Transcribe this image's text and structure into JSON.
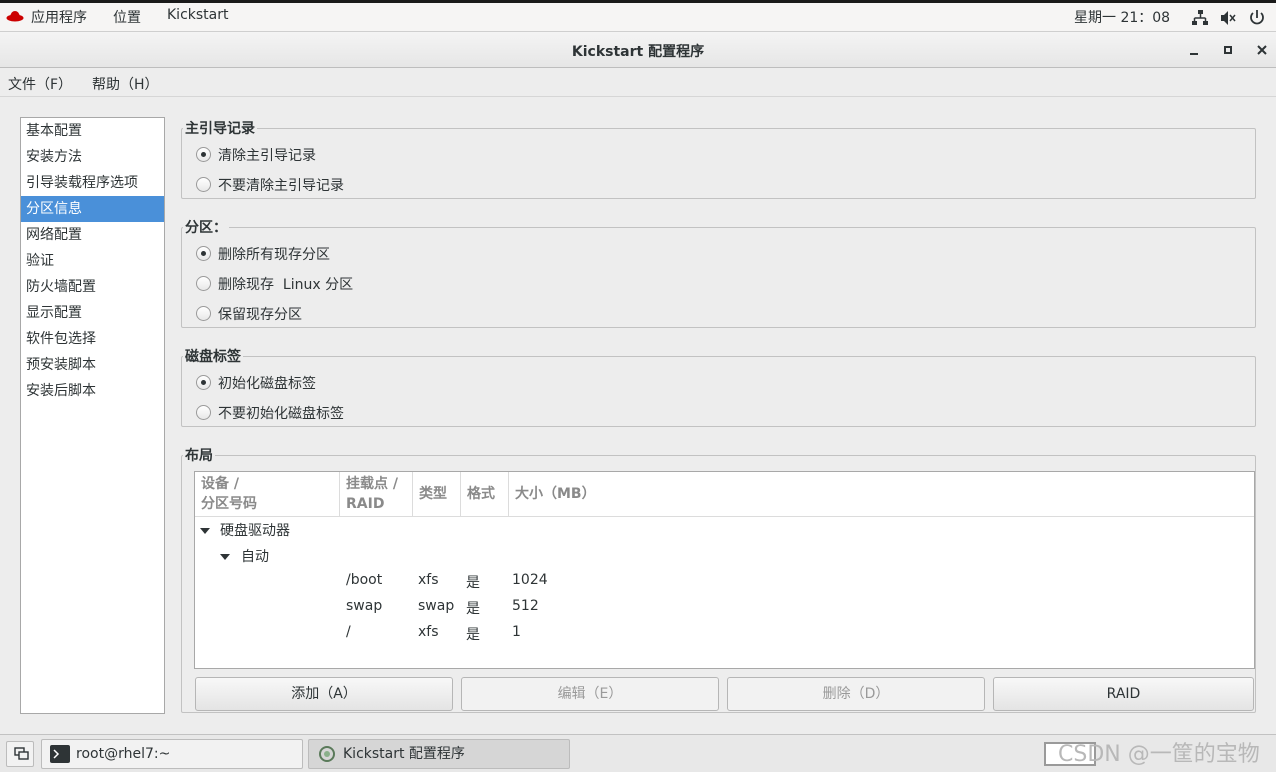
{
  "top_panel": {
    "applications": "应用程序",
    "places": "位置",
    "active_app": "Kickstart",
    "clock": "星期一 21：08",
    "icons": [
      "network-icon",
      "volume-icon",
      "power-icon"
    ]
  },
  "window": {
    "title": "Kickstart 配置程序",
    "minimize": "_",
    "maximize": "▫",
    "close": "✕"
  },
  "menubar": {
    "file": "文件（F）",
    "help": "帮助（H）"
  },
  "sidebar": {
    "items": [
      {
        "label": "基本配置"
      },
      {
        "label": "安装方法"
      },
      {
        "label": "引导装载程序选项"
      },
      {
        "label": "分区信息",
        "selected": true
      },
      {
        "label": "网络配置"
      },
      {
        "label": "验证"
      },
      {
        "label": "防火墙配置"
      },
      {
        "label": "显示配置"
      },
      {
        "label": "软件包选择"
      },
      {
        "label": "预安装脚本"
      },
      {
        "label": "安装后脚本"
      }
    ]
  },
  "mbr": {
    "title": "主引导记录",
    "options": [
      {
        "label": "清除主引导记录",
        "checked": true
      },
      {
        "label": "不要清除主引导记录",
        "checked": false
      }
    ]
  },
  "partitions": {
    "title": "分区：",
    "options": [
      {
        "label": "删除所有现存分区",
        "checked": true
      },
      {
        "label": "删除现存  Linux 分区",
        "checked": false
      },
      {
        "label": "保留现存分区",
        "checked": false
      }
    ]
  },
  "disklabel": {
    "title": "磁盘标签",
    "options": [
      {
        "label": "初始化磁盘标签",
        "checked": true
      },
      {
        "label": "不要初始化磁盘标签",
        "checked": false
      }
    ]
  },
  "layout": {
    "title": "布局",
    "columns": [
      "设备 /\n分区号码",
      "挂载点 /\nRAID",
      "类型",
      "格式",
      "大小（MB）"
    ],
    "tree_root": "硬盘驱动器",
    "tree_child": "自动",
    "rows": [
      {
        "mount": "/boot",
        "type": "xfs",
        "format": "是",
        "size": "1024"
      },
      {
        "mount": "swap",
        "type": "swap",
        "format": "是",
        "size": "512"
      },
      {
        "mount": "/",
        "type": "xfs",
        "format": "是",
        "size": "1"
      }
    ]
  },
  "buttons": {
    "add": "添加（A）",
    "edit": "编辑（E）",
    "delete": "删除（D）",
    "raid": "RAID"
  },
  "taskbar": {
    "terminal": "root@rhel7:~",
    "kickstart": "Kickstart 配置程序"
  },
  "watermark": "CSDN @一筐的宝物",
  "colors": {
    "selection": "#4a90d9",
    "panel": "#f6f5f4",
    "window_bg": "#ededed"
  }
}
